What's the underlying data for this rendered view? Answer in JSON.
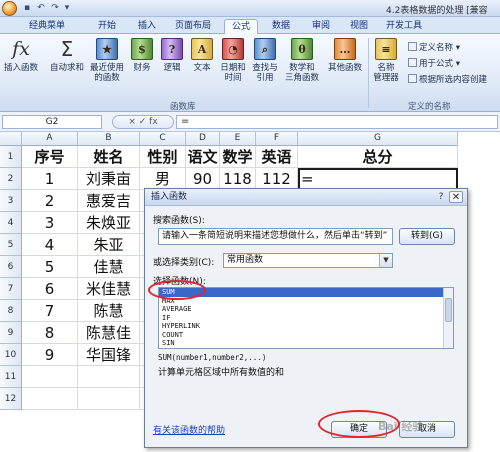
{
  "window": {
    "title": "4.2表格数据的处理 [兼容"
  },
  "ribbon_tabs": [
    "经典菜单",
    "开始",
    "插入",
    "页面布局",
    "公式",
    "数据",
    "审阅",
    "视图",
    "开发工具"
  ],
  "ribbon_active_tab": "公式",
  "function_library": {
    "group_label": "函数库",
    "insert_function": "插入函数",
    "autosum": "自动求和",
    "recent_line1": "最近使用",
    "recent_line2": "的函数",
    "financial": "财务",
    "logical": "逻辑",
    "text": "文本",
    "datetime_line1": "日期和",
    "datetime_line2": "时间",
    "lookup_line1": "查找与",
    "lookup_line2": "引用",
    "math_line1": "数学和",
    "math_line2": "三角函数",
    "more": "其他函数"
  },
  "defined_names": {
    "group_label": "定义的名称",
    "manager_line1": "名称",
    "manager_line2": "管理器",
    "define_name": "定义名称",
    "use_in_formula": "用于公式",
    "create_from_selection": "根据所选内容创建"
  },
  "formula_bar": {
    "cell_ref": "G2",
    "buttons": "× ✓ fx",
    "content": "="
  },
  "sheet": {
    "columns": [
      "A",
      "B",
      "C",
      "D",
      "E",
      "F",
      "G"
    ],
    "rows": [
      "1",
      "2",
      "3",
      "4",
      "5",
      "6",
      "7",
      "8",
      "9",
      "10",
      "11",
      "12"
    ],
    "header": [
      "序号",
      "姓名",
      "性别",
      "语文",
      "数学",
      "英语",
      "总分"
    ],
    "data": [
      [
        "1",
        "刘秉亩",
        "男",
        "90",
        "118",
        "112",
        "="
      ],
      [
        "2",
        "惠爱吉",
        "",
        "",
        "",
        "",
        ""
      ],
      [
        "3",
        "朱焕亚",
        "",
        "",
        "",
        "",
        ""
      ],
      [
        "4",
        "朱亚",
        "",
        "",
        "",
        "",
        ""
      ],
      [
        "5",
        "佳慧",
        "",
        "",
        "",
        "",
        ""
      ],
      [
        "6",
        "米佳慧",
        "",
        "",
        "",
        "",
        ""
      ],
      [
        "7",
        "陈慧",
        "",
        "",
        "",
        "",
        ""
      ],
      [
        "8",
        "陈慧佳",
        "",
        "",
        "",
        "",
        ""
      ],
      [
        "9",
        "华国锋",
        "",
        "",
        "",
        "",
        ""
      ]
    ]
  },
  "dialog": {
    "title": "插入函数",
    "search_label": "搜索函数(S):",
    "search_value": "请输入一条简短说明来描述您想做什么，然后单击“转到”",
    "goto_button": "转到(G)",
    "category_label": "或选择类别(C):",
    "category_value": "常用函数",
    "list_label": "选择函数(N):",
    "functions": [
      "SUM",
      "MAX",
      "AVERAGE",
      "IF",
      "HYPERLINK",
      "COUNT",
      "SIN"
    ],
    "selected_function": "SUM",
    "signature": "SUM(number1,number2,...)",
    "description": "计算单元格区域中所有数值的和",
    "help_link": "有关该函数的帮助",
    "ok_button": "确定",
    "cancel_button": "取消"
  },
  "watermark": "Bai 经验"
}
